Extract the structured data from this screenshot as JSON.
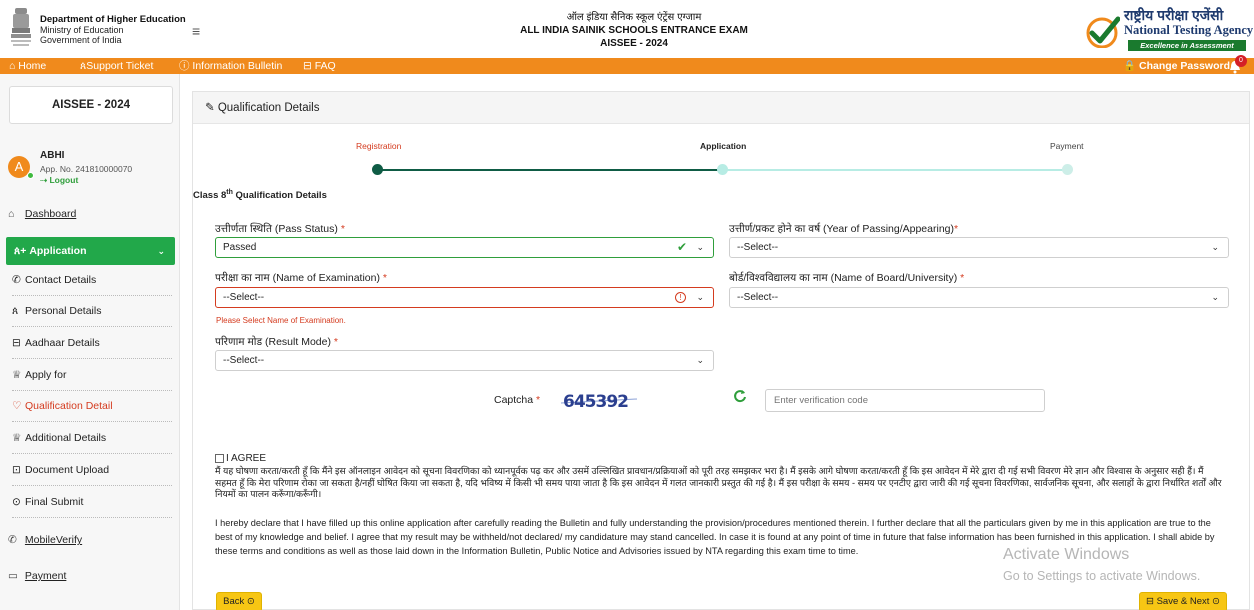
{
  "header": {
    "dept_line1": "Department of Higher Education",
    "dept_line2": "Ministry of Education",
    "dept_line3": "Government of India",
    "title_hindi": "ऑल इंडिया सैनिक स्कूल एंट्रेंस एग्जाम",
    "title_english": "ALL INDIA SAINIK SCHOOLS ENTRANCE EXAM",
    "title_code": "AISSEE - 2024",
    "nta_hindi": "राष्ट्रीय परीक्षा एजेंसी",
    "nta_english": "National Testing Agency",
    "nta_tagline": "Excellence in Assessment",
    "menu_icon": "hamburger-icon",
    "emblem_icon": "national-emblem-icon"
  },
  "nav": {
    "home": "⌂ Home",
    "support": "ጰSupport Ticket",
    "bulletin": "ⓘ Information Bulletin",
    "faq": "⊟ FAQ",
    "change_password": "🔒 Change Password",
    "bell_count": "0",
    "bell_icon": "bell-icon"
  },
  "sidebar": {
    "title": "AISSEE - 2024",
    "avatar_letter": "A",
    "user_name": "ABHI",
    "app_no": "App. No. 241810000070",
    "logout": "⇢ Logout",
    "dashboard": "Dashboard",
    "application": "Application",
    "sub_items": [
      {
        "label": "Contact Details",
        "icon": "phone-icon"
      },
      {
        "label": "Personal Details",
        "icon": "person-icon"
      },
      {
        "label": "Aadhaar Details",
        "icon": "id-card-icon"
      },
      {
        "label": "Apply for",
        "icon": "trophy-icon"
      },
      {
        "label": "Qualification Detail",
        "icon": "qualification-icon"
      },
      {
        "label": "Additional Details",
        "icon": "trophy-icon"
      },
      {
        "label": "Document Upload",
        "icon": "upload-icon"
      },
      {
        "label": "Final Submit",
        "icon": "check-circle-icon"
      }
    ],
    "mobile_verify": "MobileVerify",
    "payment": "Payment"
  },
  "card": {
    "title": "Qualification Details"
  },
  "stepper": {
    "steps": [
      "Registration",
      "Application",
      "Payment"
    ]
  },
  "section": {
    "title_pre": "Class 8",
    "title_sup": "th",
    "title_post": " Qualification Details"
  },
  "form": {
    "pass_status_label": "उत्तीर्णता स्थिति (Pass Status) ",
    "pass_status_value": "Passed",
    "year_label": "उत्तीर्ण/प्रकट होने का वर्ष (Year of Passing/Appearing)",
    "year_value": "--Select--",
    "exam_label": "परीक्षा का नाम (Name of Examination) ",
    "exam_value": "--Select--",
    "exam_error": "Please Select Name of Examination.",
    "board_label": "बोर्ड/विश्वविद्यालय का नाम (Name of Board/University) ",
    "board_value": "--Select--",
    "result_label": "परिणाम मोड (Result Mode) ",
    "result_value": "--Select--",
    "required_mark": "*",
    "captcha_label": "Captcha ",
    "captcha_text": "645392",
    "captcha_placeholder": "Enter verification code"
  },
  "declaration": {
    "agree_label": "I AGREE",
    "hindi": "मैं यह घोषणा करता/करती हूँ कि मैंने इस ऑनलाइन आवेदन को सूचना विवरणिका को ध्यानपूर्वक पढ़ कर और उसमें उल्लिखित प्रावधान/प्रक्रियाओं को पूरी तरह समझकर भरा है। मैं इसके आगे घोषणा करता/करती हूँ कि इस आवेदन में मेरे द्वारा दी गई सभी विवरण मेरे ज्ञान और विश्वास के अनुसार सही हैं। मैं सहमत हूँ कि मेरा परिणाम रोका जा सकता है/नहीं घोषित किया जा सकता है, यदि भविष्य में किसी भी समय पाया जाता है कि इस आवेदन में गलत जानकारी प्रस्तुत की गई है। मैं इस परीक्षा के समय - समय पर एनटीए द्वारा जारी की गई सूचना विवरणिका, सार्वजनिक सूचना, और सलाहों के द्वारा निर्धारित शर्तों और नियमों का पालन करूँगा/करूँगी।",
    "english": "I hereby declare that I have filled up this online application after carefully reading the Bulletin and fully understanding the provision/procedures mentioned therein. I further declare that all the particulars given by me in this application are true to the best of my knowledge and belief. I agree that my result may be withheld/not declared/ my candidature may stand cancelled. In case it is found at any point of time in future that false information has been furnished in this application. I shall abide by these terms and conditions as well as those laid down in the Information Bulletin, Public Notice and Advisories issued by NTA regarding this exam time to time."
  },
  "buttons": {
    "back": "Back ⊙",
    "save_next": "⊟ Save & Next ⊙"
  },
  "watermark": {
    "line1": "Activate Windows",
    "line2": "Go to Settings to activate Windows."
  },
  "colors": {
    "nav_orange": "#f08a1c",
    "sidebar_active_green": "#22a84a",
    "error_red": "#d43b1f",
    "stepper_teal": "#0f5c45",
    "button_yellow": "#f7c614"
  }
}
